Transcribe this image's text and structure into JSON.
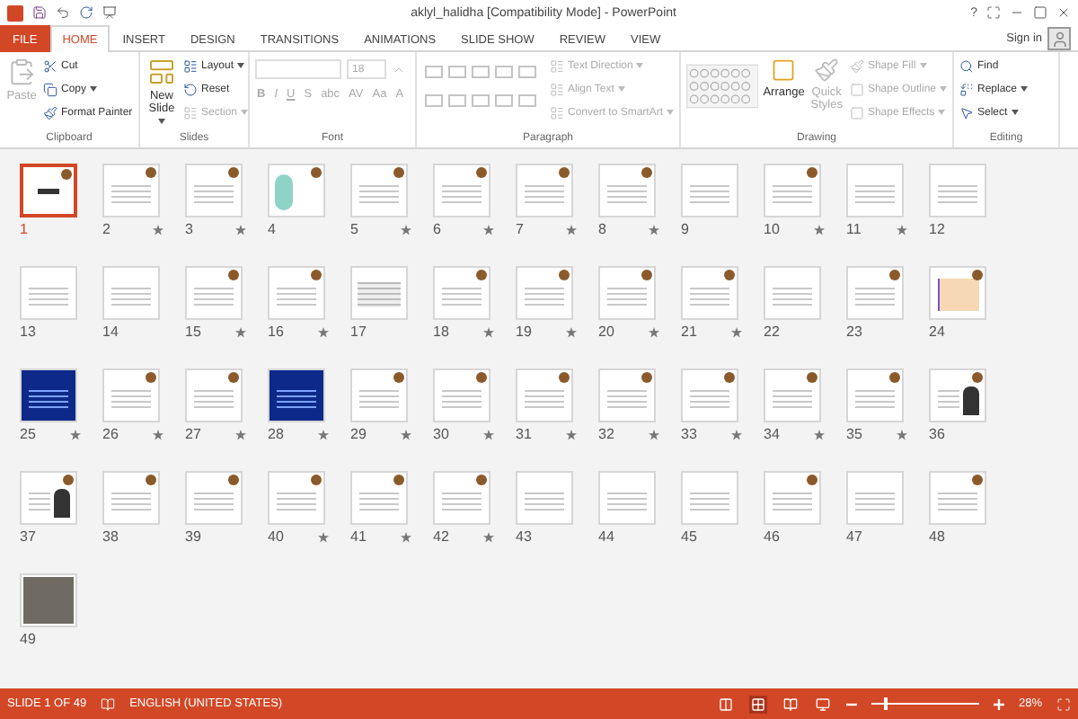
{
  "window": {
    "title": "aklyl_halidha [Compatibility Mode] - PowerPoint",
    "help": "?"
  },
  "tabs": [
    {
      "label": "FILE",
      "kind": "file",
      "selected": false
    },
    {
      "label": "HOME",
      "kind": "tab",
      "selected": true
    },
    {
      "label": "INSERT",
      "kind": "tab",
      "selected": false
    },
    {
      "label": "DESIGN",
      "kind": "tab",
      "selected": false
    },
    {
      "label": "TRANSITIONS",
      "kind": "tab",
      "selected": false
    },
    {
      "label": "ANIMATIONS",
      "kind": "tab",
      "selected": false
    },
    {
      "label": "SLIDE SHOW",
      "kind": "tab",
      "selected": false
    },
    {
      "label": "REVIEW",
      "kind": "tab",
      "selected": false
    },
    {
      "label": "VIEW",
      "kind": "tab",
      "selected": false
    }
  ],
  "account": {
    "label": "Sign in"
  },
  "ribbon": {
    "clipboard": {
      "label": "Clipboard",
      "paste": {
        "label": "Paste",
        "disabled": true
      },
      "items": [
        {
          "label": "Cut",
          "disabled": false,
          "dropdown": false
        },
        {
          "label": "Copy",
          "disabled": false,
          "dropdown": true
        },
        {
          "label": "Format Painter",
          "disabled": false,
          "dropdown": false
        }
      ]
    },
    "slides": {
      "label": "Slides",
      "new_slide": {
        "label": "New Slide",
        "disabled": false
      },
      "items": [
        {
          "label": "Layout",
          "disabled": false,
          "dropdown": true
        },
        {
          "label": "Reset",
          "disabled": false,
          "dropdown": false
        },
        {
          "label": "Section",
          "disabled": true,
          "dropdown": true
        }
      ]
    },
    "font": {
      "label": "Font",
      "disabled": true,
      "font_size": {
        "value": "18"
      },
      "buttons": [
        "B",
        "I",
        "U",
        "S",
        "abc",
        "AV",
        "Aa",
        "A"
      ]
    },
    "paragraph": {
      "label": "Paragraph",
      "items": [
        {
          "label": "Text Direction",
          "disabled": true,
          "dropdown": true
        },
        {
          "label": "Align Text",
          "disabled": true,
          "dropdown": true
        },
        {
          "label": "Convert to SmartArt",
          "disabled": true,
          "dropdown": true
        }
      ]
    },
    "drawing": {
      "label": "Drawing",
      "arrange": {
        "label": "Arrange",
        "disabled": false
      },
      "quick_styles": {
        "label": "Quick Styles",
        "disabled": true
      },
      "items": [
        {
          "label": "Shape Fill",
          "disabled": true,
          "dropdown": true
        },
        {
          "label": "Shape Outline",
          "disabled": true,
          "dropdown": true
        },
        {
          "label": "Shape Effects",
          "disabled": true,
          "dropdown": true
        }
      ]
    },
    "editing": {
      "label": "Editing",
      "items": [
        {
          "label": "Find",
          "disabled": false,
          "dropdown": false
        },
        {
          "label": "Replace",
          "disabled": false,
          "dropdown": true
        },
        {
          "label": "Select",
          "disabled": false,
          "dropdown": true
        }
      ]
    }
  },
  "slides": [
    {
      "number": "1",
      "kind": "title",
      "logo": true,
      "animated": false,
      "selected": true
    },
    {
      "number": "2",
      "kind": "text",
      "logo": true,
      "animated": true,
      "selected": false
    },
    {
      "number": "3",
      "kind": "text",
      "logo": true,
      "animated": true,
      "selected": false
    },
    {
      "number": "4",
      "kind": "bubbles",
      "logo": true,
      "animated": false,
      "selected": false
    },
    {
      "number": "5",
      "kind": "text",
      "logo": true,
      "animated": true,
      "selected": false
    },
    {
      "number": "6",
      "kind": "text",
      "logo": true,
      "animated": true,
      "selected": false
    },
    {
      "number": "7",
      "kind": "text",
      "logo": true,
      "animated": true,
      "selected": false
    },
    {
      "number": "8",
      "kind": "text",
      "logo": true,
      "animated": true,
      "selected": false
    },
    {
      "number": "9",
      "kind": "text",
      "logo": false,
      "animated": false,
      "selected": false
    },
    {
      "number": "10",
      "kind": "text",
      "logo": true,
      "animated": true,
      "selected": false
    },
    {
      "number": "11",
      "kind": "text",
      "logo": false,
      "animated": true,
      "selected": false
    },
    {
      "number": "12",
      "kind": "text",
      "logo": false,
      "animated": false,
      "selected": false
    },
    {
      "number": "13",
      "kind": "text",
      "logo": false,
      "animated": false,
      "selected": false
    },
    {
      "number": "14",
      "kind": "text",
      "logo": false,
      "animated": false,
      "selected": false
    },
    {
      "number": "15",
      "kind": "text",
      "logo": true,
      "animated": true,
      "selected": false
    },
    {
      "number": "16",
      "kind": "text",
      "logo": true,
      "animated": true,
      "selected": false
    },
    {
      "number": "17",
      "kind": "table",
      "logo": false,
      "animated": false,
      "selected": false
    },
    {
      "number": "18",
      "kind": "text",
      "logo": true,
      "animated": true,
      "selected": false
    },
    {
      "number": "19",
      "kind": "text",
      "logo": true,
      "animated": true,
      "selected": false
    },
    {
      "number": "20",
      "kind": "text",
      "logo": true,
      "animated": true,
      "selected": false
    },
    {
      "number": "21",
      "kind": "text",
      "logo": true,
      "animated": true,
      "selected": false
    },
    {
      "number": "22",
      "kind": "text",
      "logo": false,
      "animated": false,
      "selected": false
    },
    {
      "number": "23",
      "kind": "text",
      "logo": true,
      "animated": false,
      "selected": false
    },
    {
      "number": "24",
      "kind": "peach",
      "logo": true,
      "animated": false,
      "selected": false
    },
    {
      "number": "25",
      "kind": "dark",
      "logo": false,
      "animated": true,
      "selected": false
    },
    {
      "number": "26",
      "kind": "text",
      "logo": true,
      "animated": true,
      "selected": false
    },
    {
      "number": "27",
      "kind": "text",
      "logo": true,
      "animated": true,
      "selected": false
    },
    {
      "number": "28",
      "kind": "dark",
      "logo": false,
      "animated": true,
      "selected": false
    },
    {
      "number": "29",
      "kind": "text",
      "logo": true,
      "animated": true,
      "selected": false
    },
    {
      "number": "30",
      "kind": "text",
      "logo": true,
      "animated": true,
      "selected": false
    },
    {
      "number": "31",
      "kind": "text",
      "logo": true,
      "animated": true,
      "selected": false
    },
    {
      "number": "32",
      "kind": "text",
      "logo": true,
      "animated": true,
      "selected": false
    },
    {
      "number": "33",
      "kind": "text",
      "logo": true,
      "animated": true,
      "selected": false
    },
    {
      "number": "34",
      "kind": "text",
      "logo": true,
      "animated": true,
      "selected": false
    },
    {
      "number": "35",
      "kind": "text",
      "logo": true,
      "animated": true,
      "selected": false
    },
    {
      "number": "36",
      "kind": "portrait",
      "logo": true,
      "animated": false,
      "selected": false
    },
    {
      "number": "37",
      "kind": "portrait",
      "logo": true,
      "animated": false,
      "selected": false
    },
    {
      "number": "38",
      "kind": "text",
      "logo": true,
      "animated": false,
      "selected": false
    },
    {
      "number": "39",
      "kind": "text",
      "logo": true,
      "animated": false,
      "selected": false
    },
    {
      "number": "40",
      "kind": "text",
      "logo": true,
      "animated": true,
      "selected": false
    },
    {
      "number": "41",
      "kind": "text",
      "logo": true,
      "animated": true,
      "selected": false
    },
    {
      "number": "42",
      "kind": "text",
      "logo": true,
      "animated": true,
      "selected": false
    },
    {
      "number": "43",
      "kind": "text",
      "logo": false,
      "animated": false,
      "selected": false
    },
    {
      "number": "44",
      "kind": "text",
      "logo": false,
      "animated": false,
      "selected": false
    },
    {
      "number": "45",
      "kind": "text",
      "logo": false,
      "animated": false,
      "selected": false
    },
    {
      "number": "46",
      "kind": "text",
      "logo": true,
      "animated": false,
      "selected": false
    },
    {
      "number": "47",
      "kind": "text",
      "logo": false,
      "animated": false,
      "selected": false
    },
    {
      "number": "48",
      "kind": "text",
      "logo": true,
      "animated": false,
      "selected": false
    },
    {
      "number": "49",
      "kind": "photo",
      "logo": false,
      "animated": false,
      "selected": false
    }
  ],
  "status_bar": {
    "slide": "SLIDE 1 OF 49",
    "language": "ENGLISH (UNITED STATES)",
    "views": [
      {
        "kind": "normal",
        "selected": false
      },
      {
        "kind": "sorter",
        "selected": true
      },
      {
        "kind": "reading",
        "selected": false
      },
      {
        "kind": "slideshow",
        "selected": false
      }
    ],
    "zoom_slider": {
      "level": 0.12
    },
    "zoom": "28%"
  }
}
